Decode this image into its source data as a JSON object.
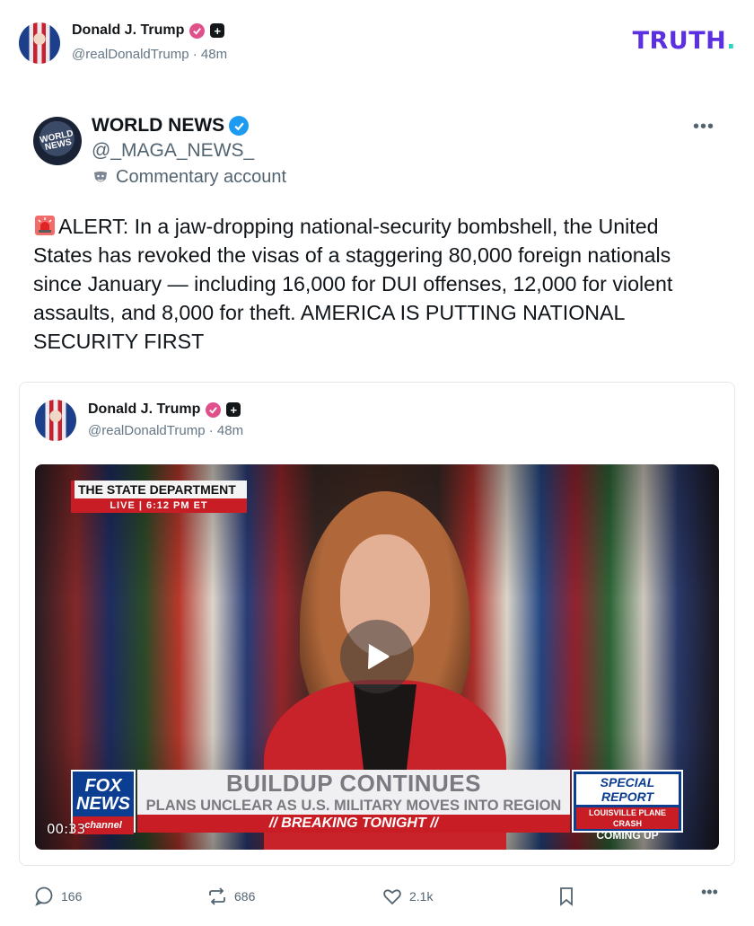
{
  "header": {
    "author_name": "Donald J. Trump",
    "handle": "@realDonaldTrump",
    "separator": "·",
    "time": "48m",
    "plus_badge": "+",
    "logo_text": "TRUTH",
    "logo_dot": "."
  },
  "quoted_post": {
    "account_name": "WORLD NEWS",
    "avatar_text": "WORLD NEWS",
    "handle": "@_MAGA_NEWS_",
    "account_label": "Commentary account",
    "more": "•••",
    "text": "ALERT: In a jaw-dropping national-security bombshell, the United States has revoked the visas of a staggering 80,000 foreign nationals since January — including 16,000 for DUI offenses, 12,000 for violent assaults, and 8,000 for theft. AMERICA IS PUTTING NATIONAL SECURITY FIRST"
  },
  "embedded_post": {
    "author_name": "Donald J. Trump",
    "handle": "@realDonaldTrump",
    "separator": "·",
    "time": "48m",
    "plus_badge": "+",
    "video": {
      "state_tag_title": "THE STATE DEPARTMENT",
      "state_tag_live": "LIVE  |  6:12 PM ET",
      "network_logo": "FOX NEWS",
      "network_sub": "channel",
      "headline": "BUILDUP CONTINUES",
      "subheadline": "PLANS UNCLEAR AS U.S. MILITARY MOVES INTO REGION",
      "ticker": "// BREAKING TONIGHT //",
      "special_title": "SPECIAL REPORT",
      "special_sub": "LOUISVILLE PLANE CRASH",
      "special_footer": "COMING UP",
      "timecode": "00:33"
    }
  },
  "actions": {
    "replies": "166",
    "reposts": "686",
    "likes": "2.1k",
    "more": "•••"
  },
  "colors": {
    "truth_purple": "#5b30e0",
    "truth_dot": "#2dd4bf",
    "verified_blue": "#1d9bf0",
    "verified_pink": "#e0508a",
    "fox_red": "#c81d25",
    "fox_blue": "#0b3d91"
  }
}
